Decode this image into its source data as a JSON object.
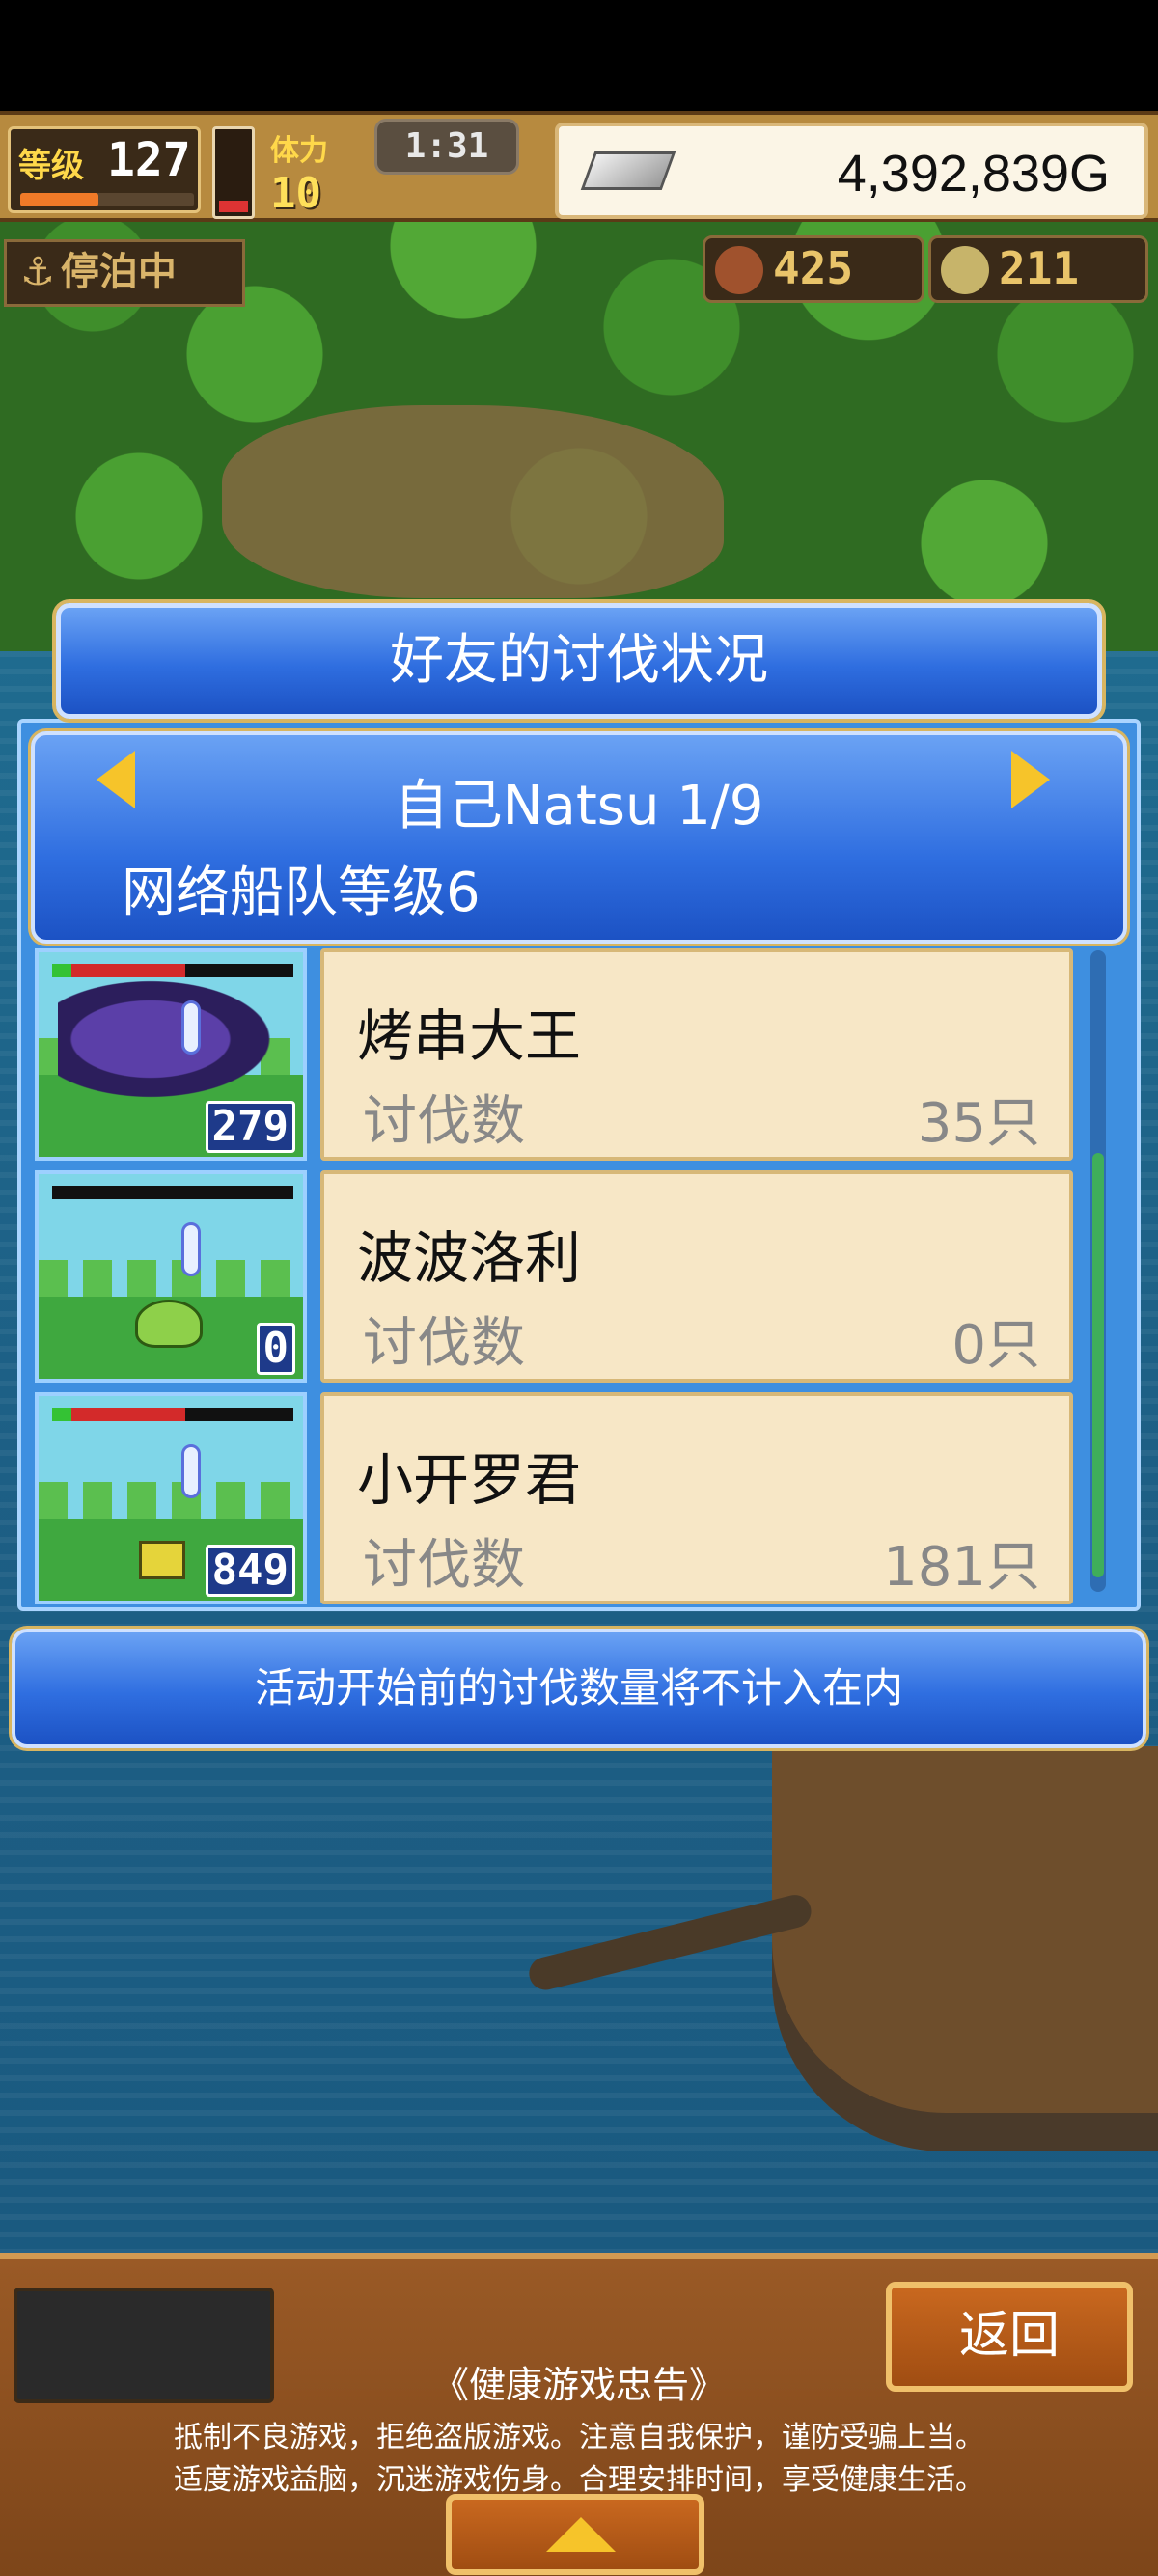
{
  "hud": {
    "level_label": "等级",
    "level_value": "127",
    "level_progress": 0.45,
    "stamina_label": "体力",
    "stamina_value": "10",
    "timer": "1:31",
    "gold": "4,392,839G"
  },
  "status": {
    "moored_label": "停泊中",
    "food": "425",
    "medals": "211"
  },
  "dialog": {
    "title": "好友的讨伐状况",
    "friend_name": "自己Natsu 1/9",
    "fleet_level": "网络船队等级6",
    "notice": "活动开始前的讨伐数量将不计入在内"
  },
  "entries": [
    {
      "name": "烤串大王",
      "kill_label": "讨伐数",
      "kills": "35只",
      "level": "279",
      "hp": 0.55
    },
    {
      "name": "波波洛利",
      "kill_label": "讨伐数",
      "kills": "0只",
      "level": "0",
      "hp": 0.0
    },
    {
      "name": "小开罗君",
      "kill_label": "讨伐数",
      "kills": "181只",
      "level": "849",
      "hp": 0.55
    }
  ],
  "footer": {
    "back_label": "返回",
    "health_title": "《健康游戏忠告》",
    "health_line1": "抵制不良游戏，拒绝盗版游戏。注意自我保护，谨防受骗上当。",
    "health_line2": "适度游戏益脑，沉迷游戏伤身。合理安排时间，享受健康生活。"
  },
  "colors": {
    "panel_blue": "#2f6ee0",
    "card_bg": "#f7e7c6",
    "accent_gold": "#f6c42a"
  }
}
